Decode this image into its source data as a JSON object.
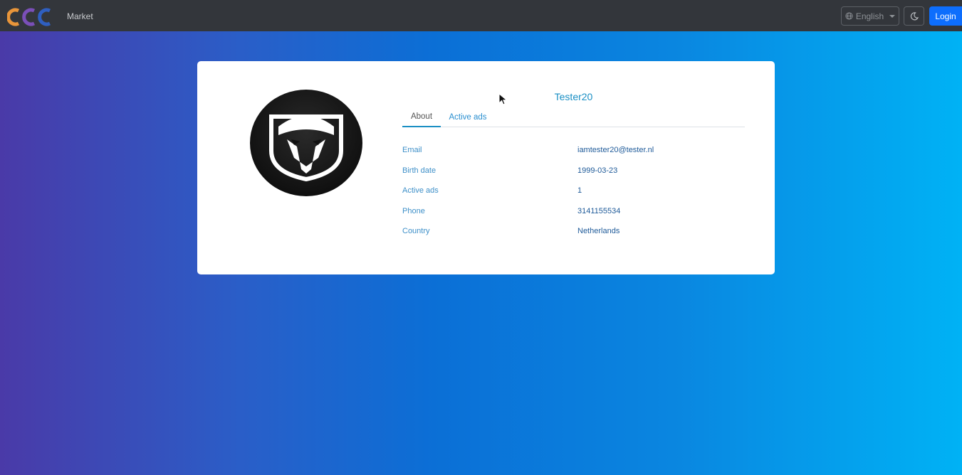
{
  "navbar": {
    "brand_text": "Market",
    "language_label": "English",
    "login_label": "Login"
  },
  "icons": {
    "logo": "ccc-logo",
    "language": "globe-icon",
    "theme": "moon-icon",
    "avatar": "viper-snake-logo"
  },
  "profile": {
    "username": "Tester20",
    "tabs": [
      {
        "label": "About",
        "active": true
      },
      {
        "label": "Active ads",
        "active": false
      }
    ],
    "fields": [
      {
        "label": "Email",
        "value": "iamtester20@tester.nl"
      },
      {
        "label": "Birth date",
        "value": "1999-03-23"
      },
      {
        "label": "Active ads",
        "value": "1"
      },
      {
        "label": "Phone",
        "value": "3141155534"
      },
      {
        "label": "Country",
        "value": "Netherlands"
      }
    ]
  },
  "colors": {
    "navbar_bg": "#33363b",
    "accent": "#1a8fc4",
    "login_bg": "#0d6efd"
  }
}
